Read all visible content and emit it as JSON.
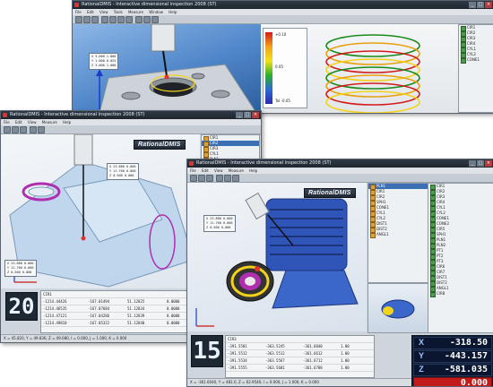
{
  "colors": {
    "title_bar": "#1e252d",
    "chrome": "#cfd5dc",
    "viewport_blue": "#5e8fc7",
    "dro_bg": "#0f1c35",
    "error_red": "#c21b1b",
    "accent_yellow": "#f2d21a",
    "accent_magenta": "#b02fae"
  },
  "windows": {
    "top": {
      "title": "RationalDMIS - Interactive dimensional inspection 2008 (ST)",
      "menu": [
        "File",
        "Edit",
        "View",
        "Tools",
        "Measure",
        "Window",
        "Help"
      ],
      "icons": [
        "gear-icon",
        "probe-icon",
        "cylinder-icon",
        "report-icon"
      ],
      "tag_lines": [
        "X 3.000 1.000",
        "Y 1.000 0.025",
        "Z 3.000 1.000"
      ],
      "legend": [
        "Tol -0.05",
        "0.05",
        "+0.10"
      ]
    },
    "middle": {
      "title": "RationalDMIS - Interactive dimensional inspection 2008 (ST)",
      "menu": [
        "File",
        "Edit",
        "View",
        "Measure",
        "Help"
      ],
      "brand": "RationalDMIS",
      "counter": "20",
      "status": "X = 45.820, Y = 49.836, Z = 49.080, I = 0.000, J = 1.000, K = 0.000",
      "tag_lines": [
        "X 23.880 0.000",
        "Y 11.760 0.000",
        "Z 0.500 0.000"
      ],
      "tree": [
        "CIR1",
        "CIR2",
        "CIR3",
        "CYL1",
        "PLN1"
      ],
      "readout_header": "CIR1",
      "readout_rows": [
        [
          "-1214.44426",
          "-167.01494",
          "51.12825",
          "0.0000"
        ],
        [
          "-1214.46535",
          "-167.07684",
          "51.12834",
          "0.0000"
        ],
        [
          "-1214.47121",
          "-167.04286",
          "51.12839",
          "0.0000"
        ],
        [
          "-1214.49810",
          "-167.05322",
          "51.12840",
          "0.0000"
        ]
      ]
    },
    "front": {
      "title": "RationalDMIS - Interactive dimensional inspection 2008 (ST)",
      "menu": [
        "File",
        "Edit",
        "View",
        "Measure",
        "Help"
      ],
      "brand": "RationalDMIS",
      "counter": "15",
      "status": "X = -361.6040, Y = 481.0, Z = 62.9540, I = 0.000, J = 1.000, K = 0.000",
      "tree": [
        "PLN1",
        "CIR1",
        "CIR2",
        "SPH1",
        "CONE1",
        "CYL1",
        "CYL2",
        "DIST1",
        "DIST2",
        "ANGL1"
      ],
      "feature_list": [
        "CIR1",
        "CIR2",
        "CIR3",
        "CIR4",
        "CYL1",
        "CYL2",
        "CONE1",
        "CONE2",
        "CIR5",
        "SPH1",
        "PLN1",
        "PLN2",
        "PT1",
        "PT2",
        "PT3",
        "CIR6",
        "CIR7",
        "DIST1",
        "DIST2",
        "ANGL1",
        "CIR8"
      ],
      "readout_header": "CIR3",
      "readout_rows": [
        [
          "-391.5501",
          "-363.5245",
          "-361.6040",
          "1.00"
        ],
        [
          "-391.5512",
          "-363.5512",
          "-361.6612",
          "1.00"
        ],
        [
          "-391.5534",
          "-363.5567",
          "-361.6712",
          "1.00"
        ],
        [
          "-391.5555",
          "-363.5601",
          "-361.6788",
          "1.00"
        ]
      ],
      "dro": [
        {
          "axis": "X",
          "value": "-318.50"
        },
        {
          "axis": "Y",
          "value": "-443.157"
        },
        {
          "axis": "Z",
          "value": "-581.035"
        },
        {
          "axis": "",
          "value": "0.000"
        }
      ]
    }
  }
}
